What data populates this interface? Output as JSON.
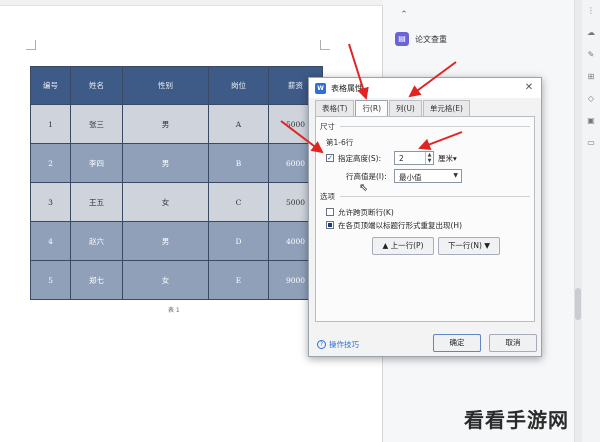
{
  "document": {
    "table": {
      "headers": [
        "编号",
        "姓名",
        "性别",
        "岗位",
        "薪资"
      ],
      "rows": [
        [
          "1",
          "张三",
          "男",
          "A",
          "5000"
        ],
        [
          "2",
          "李四",
          "男",
          "B",
          "6000"
        ],
        [
          "3",
          "王五",
          "女",
          "C",
          "5000"
        ],
        [
          "4",
          "赵六",
          "男",
          "D",
          "4000"
        ],
        [
          "5",
          "郑七",
          "女",
          "E",
          "9000"
        ]
      ]
    },
    "caption": "表 1"
  },
  "side_panel": {
    "item_label": "论文查重"
  },
  "dialog": {
    "title": "表格属性",
    "tabs": [
      "表格(T)",
      "行(R)",
      "列(U)",
      "单元格(E)"
    ],
    "active_tab": "行(R)",
    "size_group": "尺寸",
    "rows_label": "第1-6行",
    "specify_height_label": "指定高度(S):",
    "specify_height_checked": true,
    "height_value": "2",
    "height_unit": "厘米▾",
    "row_height_is_label": "行高值是(I):",
    "row_height_is_value": "最小值",
    "options_group": "选项",
    "allow_break_label": "允许跨页断行(K)",
    "allow_break_checked": false,
    "repeat_header_label": "在各页顶端以标题行形式重复出现(H)",
    "repeat_header_checked": true,
    "prev_row_label": "▲ 上一行(P)",
    "next_row_label": "下一行(N) ▼",
    "tips_label": "操作技巧",
    "ok_label": "确定",
    "cancel_label": "取消"
  },
  "watermark": "看看手游网",
  "colors": {
    "header_fill": "#3e5a86",
    "row_light": "#cfd3db",
    "row_dark": "#8fa0b8",
    "arrow": "#e02424",
    "accent": "#2f6fd6"
  }
}
